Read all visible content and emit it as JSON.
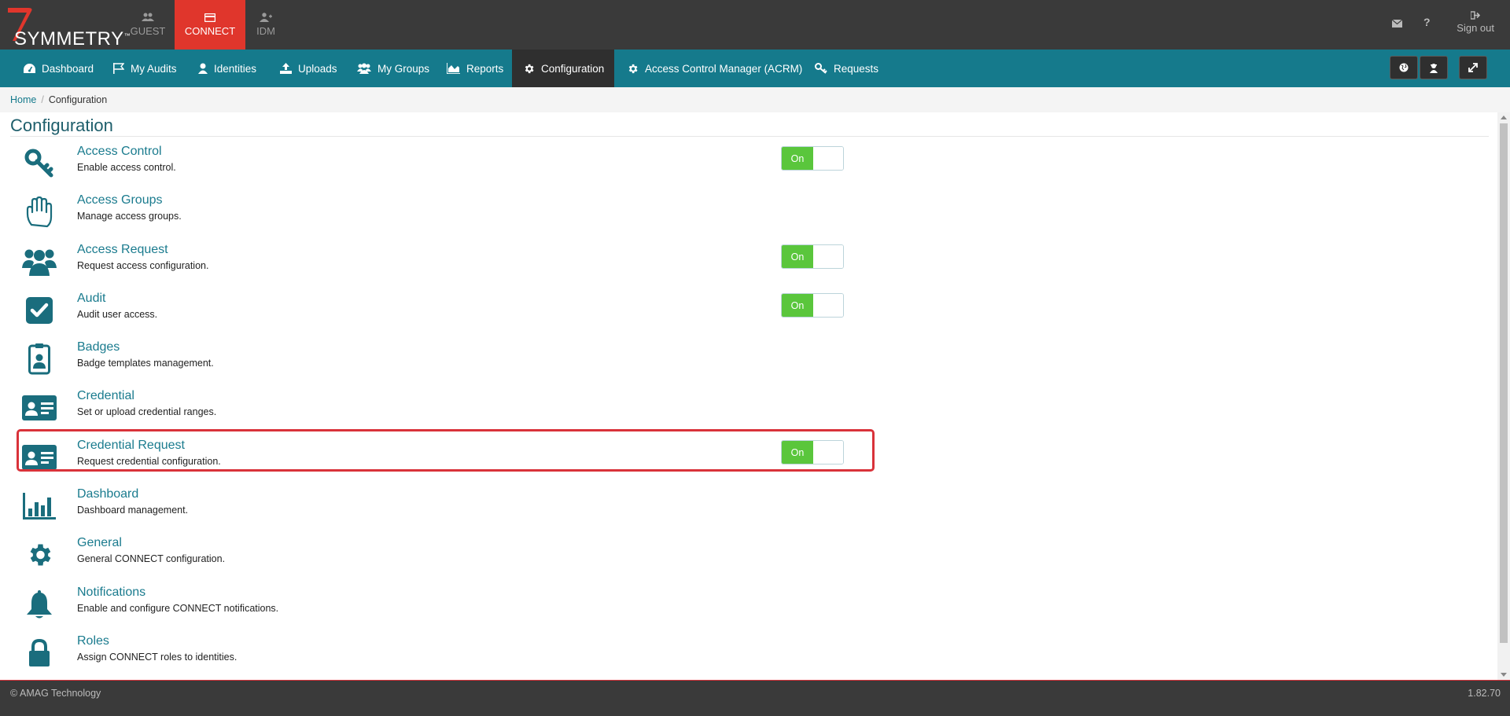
{
  "topbar": {
    "logo_text": "SYMMETRY",
    "logo_tm": "™",
    "apps": [
      {
        "label": "GUEST",
        "icon": "users-icon"
      },
      {
        "label": "CONNECT",
        "icon": "credit-card-icon",
        "active": true
      },
      {
        "label": "IDM",
        "icon": "user-plus-icon"
      }
    ],
    "signout_label": "Sign out"
  },
  "nav": {
    "items": [
      {
        "label": "Dashboard",
        "icon": "dashboard-icon"
      },
      {
        "label": "My Audits",
        "icon": "flag-icon"
      },
      {
        "label": "Identities",
        "icon": "user-icon"
      },
      {
        "label": "Uploads",
        "icon": "upload-icon"
      },
      {
        "label": "My Groups",
        "icon": "users-icon"
      },
      {
        "label": "Reports",
        "icon": "area-chart-icon"
      },
      {
        "label": "Configuration",
        "icon": "gear-icon",
        "active": true
      },
      {
        "label": "Access Control Manager (ACRM)",
        "icon": "gear-icon"
      },
      {
        "label": "Requests",
        "icon": "key-icon"
      }
    ]
  },
  "breadcrumb": {
    "home": "Home",
    "separator": "/",
    "current": "Configuration"
  },
  "page": {
    "title": "Configuration",
    "items": [
      {
        "name": "Access Control",
        "desc": "Enable access control.",
        "icon": "key-icon",
        "toggle": "On"
      },
      {
        "name": "Access Groups",
        "desc": "Manage access groups.",
        "icon": "hand-icon",
        "toggle": null
      },
      {
        "name": "Access Request",
        "desc": "Request access configuration.",
        "icon": "users-icon",
        "toggle": "On"
      },
      {
        "name": "Audit",
        "desc": "Audit user access.",
        "icon": "check-square-icon",
        "toggle": "On"
      },
      {
        "name": "Badges",
        "desc": "Badge templates management.",
        "icon": "badge-icon",
        "toggle": null
      },
      {
        "name": "Credential",
        "desc": "Set or upload credential ranges.",
        "icon": "id-card-icon",
        "toggle": null
      },
      {
        "name": "Credential Request",
        "desc": "Request credential configuration.",
        "icon": "id-card-icon",
        "toggle": "On"
      },
      {
        "name": "Dashboard",
        "desc": "Dashboard management.",
        "icon": "bar-chart-icon",
        "toggle": null
      },
      {
        "name": "General",
        "desc": "General CONNECT configuration.",
        "icon": "gear-icon",
        "toggle": null
      },
      {
        "name": "Notifications",
        "desc": "Enable and configure CONNECT notifications.",
        "icon": "bell-icon",
        "toggle": null
      },
      {
        "name": "Roles",
        "desc": "Assign CONNECT roles to identities.",
        "icon": "lock-icon",
        "toggle": null
      }
    ]
  },
  "footer": {
    "copyright": "© AMAG Technology",
    "version": "1.82.70"
  },
  "colors": {
    "nav_bg": "#157a8c",
    "topbar_bg": "#3a3a3a",
    "active_app": "#e0362c",
    "toggle_on": "#5ac63c",
    "icon": "#1a6d7d",
    "highlight": "#d9323a"
  }
}
